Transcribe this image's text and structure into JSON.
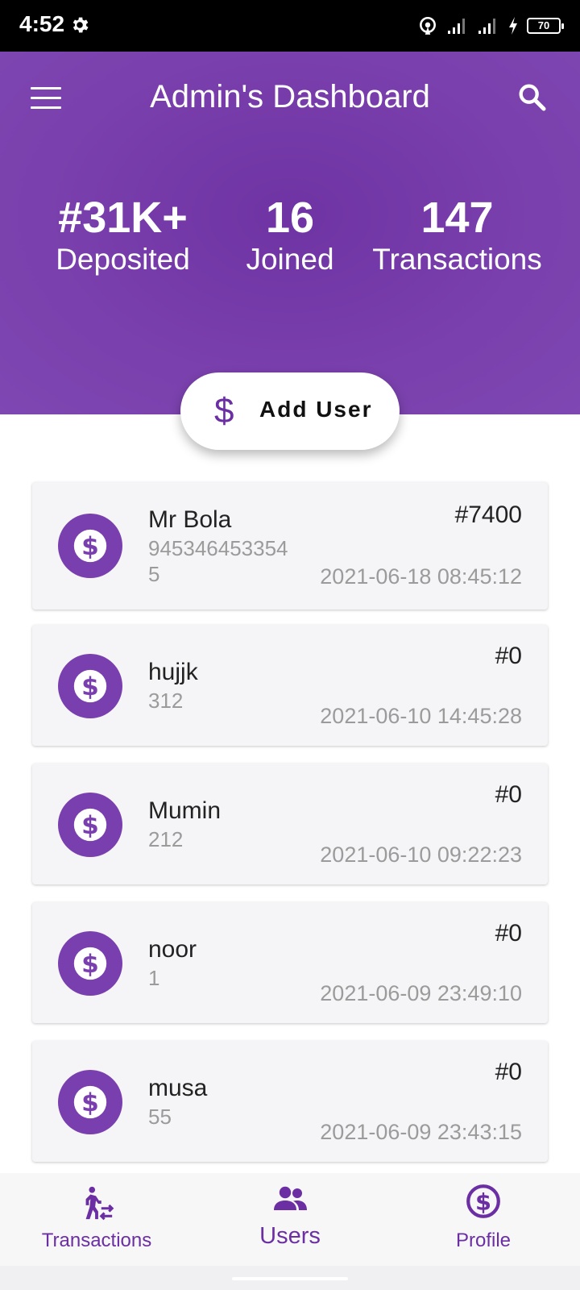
{
  "status_bar": {
    "time": "4:52",
    "battery": "70"
  },
  "header": {
    "title": "Admin's Dashboard"
  },
  "stats": [
    {
      "value": "#31K+",
      "label": "Deposited"
    },
    {
      "value": "16",
      "label": "Joined"
    },
    {
      "value": "147",
      "label": "Transactions"
    }
  ],
  "add_user": {
    "icon": "$",
    "label": "Add User"
  },
  "users": [
    {
      "name": "Mr Bola",
      "phone": "9453464533545",
      "amount": "#7400",
      "date": "2021-06-18 08:45:12"
    },
    {
      "name": "hujjk",
      "phone": "312",
      "amount": "#0",
      "date": "2021-06-10 14:45:28"
    },
    {
      "name": "Mumin",
      "phone": "212",
      "amount": "#0",
      "date": "2021-06-10 09:22:23"
    },
    {
      "name": "noor",
      "phone": "1",
      "amount": "#0",
      "date": "2021-06-09 23:49:10"
    },
    {
      "name": "musa",
      "phone": "55",
      "amount": "#0",
      "date": "2021-06-09 23:43:15"
    }
  ],
  "bottom_nav": [
    {
      "label": "Transactions",
      "icon": "transfer-walk-icon"
    },
    {
      "label": "Users",
      "icon": "group-icon",
      "active": true
    },
    {
      "label": "Profile",
      "icon": "dollar-circle-icon"
    }
  ],
  "colors": {
    "primary": "#7a40ad",
    "accent": "#6b2fa3",
    "card_bg": "#f5f5f7"
  }
}
